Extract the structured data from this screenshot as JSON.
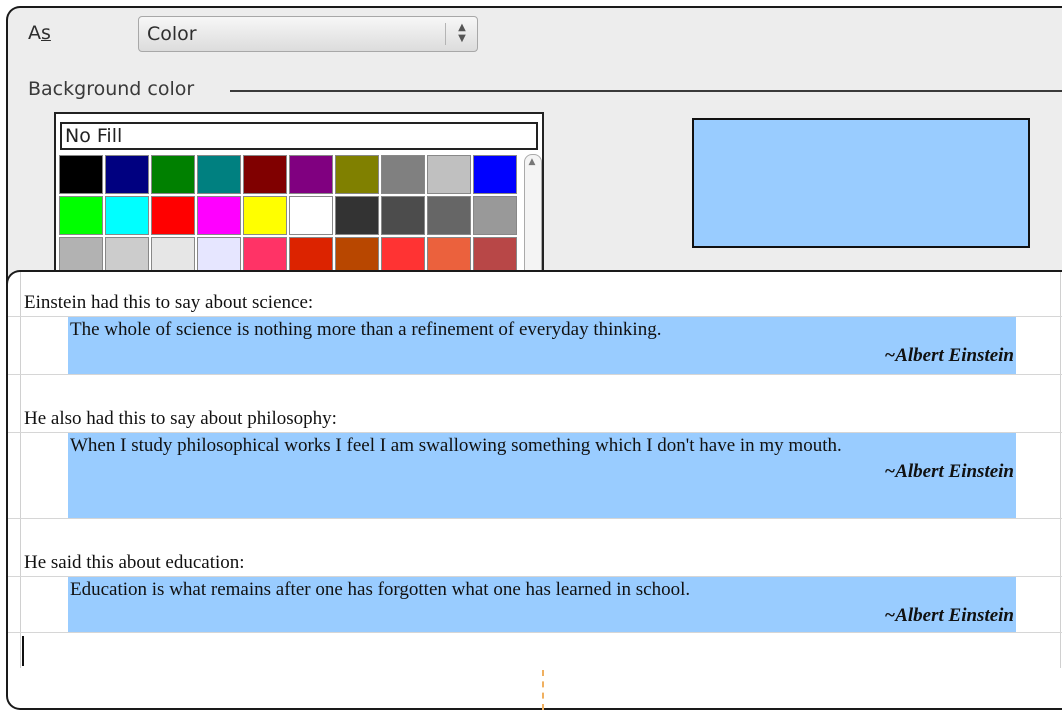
{
  "dialog": {
    "as_label_pre": "A",
    "as_label_mnemonic": "s",
    "as_value": "Color",
    "background_color_label": "Background color",
    "no_fill_label": "No Fill",
    "swatches": [
      "#000000",
      "#000080",
      "#008000",
      "#008080",
      "#800000",
      "#800080",
      "#808000",
      "#808080",
      "#c0c0c0",
      "#0000ff",
      "#00ff00",
      "#00ffff",
      "#ff0000",
      "#ff00ff",
      "#ffff00",
      "#ffffff",
      "#333333",
      "#4c4c4c",
      "#666666",
      "#999999",
      "#b2b2b2",
      "#cccccc",
      "#e6e6e6",
      "#e6e6ff",
      "#ff3366",
      "#dc2300",
      "#b84700",
      "#ff3333",
      "#eb613d",
      "#b84747"
    ],
    "preview_color": "#99ccff"
  },
  "document": {
    "blocks": [
      {
        "intro": "Einstein had this to say about science:",
        "quote": "The whole of science is nothing more than a refinement of everyday thinking.",
        "author": "~Albert Einstein"
      },
      {
        "intro": "He also had this to say about philosophy:",
        "quote": "When I study philosophical works I feel I am swallowing something which I don't have in my mouth.",
        "author": "~Albert Einstein"
      },
      {
        "intro": "He said this about education:",
        "quote": "Education is what remains after one has forgotten what one has learned in school.",
        "author": "~Albert Einstein"
      }
    ],
    "highlight_color": "#99ccff"
  }
}
